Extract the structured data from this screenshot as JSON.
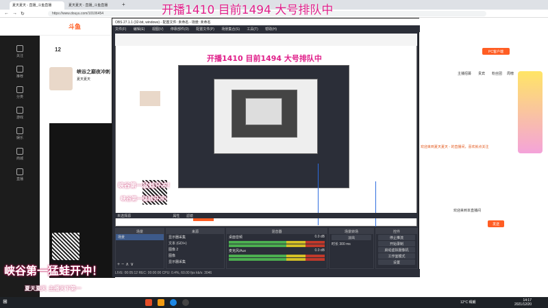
{
  "browser": {
    "tabs": [
      {
        "label": "夏天夏天 - 直播_斗鱼直播",
        "active": true
      },
      {
        "label": "夏天夏天 - 直播_斗鱼直播",
        "active": false
      }
    ],
    "new_tab": "+",
    "url": "https://www.douyu.com/10106454"
  },
  "overlay_text": "开播1410 目前1494 大号排队中",
  "douyu": {
    "logo": "斗鱼",
    "follow_count": "12",
    "stream_title": "峡谷之巅夜冲刺",
    "streamer": "夏天夏天",
    "pc_client_btn": "PC客户端",
    "right_tabs": [
      "主播招募",
      "贵宾",
      "粉丝团",
      "周榜"
    ],
    "chat_notice": "欢迎来到夏天夏天 - 的直播间，喜欢就点关注",
    "welcome": "欢迎来到本直播间",
    "send_btn": "发送"
  },
  "nav": {
    "items": [
      "关注",
      "推荐",
      "分类",
      "游戏",
      "娱乐",
      "商城",
      "直播"
    ]
  },
  "obs": {
    "title": "OBS 27.1.1 (32-bit, windows) - 配置文件: 未命名 - 场景: 未命名",
    "menu": [
      "文件(F)",
      "编辑(E)",
      "视图(V)",
      "停靠部件(D)",
      "配置文件(P)",
      "场景集合(S)",
      "工具(T)",
      "帮助(H)"
    ],
    "no_source": "未选择源",
    "properties_btn": "属性",
    "filters_btn": "滤镜",
    "docks": {
      "scenes": {
        "title": "场景",
        "items": [
          "场景"
        ]
      },
      "sources": {
        "title": "来源",
        "items": [
          "显示器采集",
          "文本 (GDI+)",
          "图像 2",
          "图像",
          "显示器采集"
        ]
      },
      "mixer": {
        "title": "混音器",
        "channels": [
          {
            "name": "桌面音频",
            "db": "0.0 dB"
          },
          {
            "name": "麦克风/Aux",
            "db": "0.0 dB"
          }
        ]
      },
      "transitions": {
        "title": "场景转场",
        "type": "淡出",
        "duration_label": "时长",
        "duration": "300 ms"
      },
      "controls": {
        "title": "控件",
        "buttons": [
          "停止推流",
          "开始录制",
          "启动虚拟摄像机",
          "工作室模式",
          "设置",
          "退出"
        ]
      }
    },
    "status": "LIVE: 00:05:12   REC: 00:00:00   CPU: 0.4%, 60.00 fps   kb/s: 3046"
  },
  "danmaku": [
    "峡谷第一猛蛙开冲！",
    "峡谷第一猛蛙开冲！",
    "夏天夏天 主播天下第一"
  ],
  "taskbar": {
    "weather": "12°C 晴朗",
    "time": "14:17",
    "date": "2021/12/20"
  },
  "colors": {
    "accent": "#ff5d23",
    "overlay": "#e0208a",
    "obs_bg": "#2b2e38",
    "taskbar": "#1e2227"
  }
}
